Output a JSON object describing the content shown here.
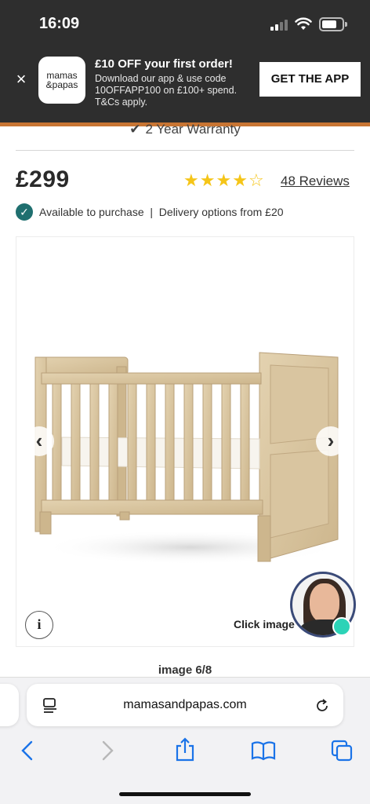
{
  "status_bar": {
    "time": "16:09"
  },
  "banner": {
    "close_icon": "×",
    "logo_line1": "mamas",
    "logo_line2": "&papas",
    "title": "£10 OFF your first order!",
    "text": "Download our app & use code 10OFFAPP100 on £100+ spend. T&Cs apply.",
    "cta": "GET THE APP",
    "accent_color": "#c87533"
  },
  "product": {
    "warranty": "2 Year Warranty",
    "price": "£299",
    "rating": 4,
    "rating_max": 5,
    "reviews": "48 Reviews",
    "availability": "Available to purchase  |  Delivery options from £20"
  },
  "gallery": {
    "click_text": "Click image",
    "counter": "image 6/8"
  },
  "browser": {
    "url": "mamasandpapas.com"
  }
}
